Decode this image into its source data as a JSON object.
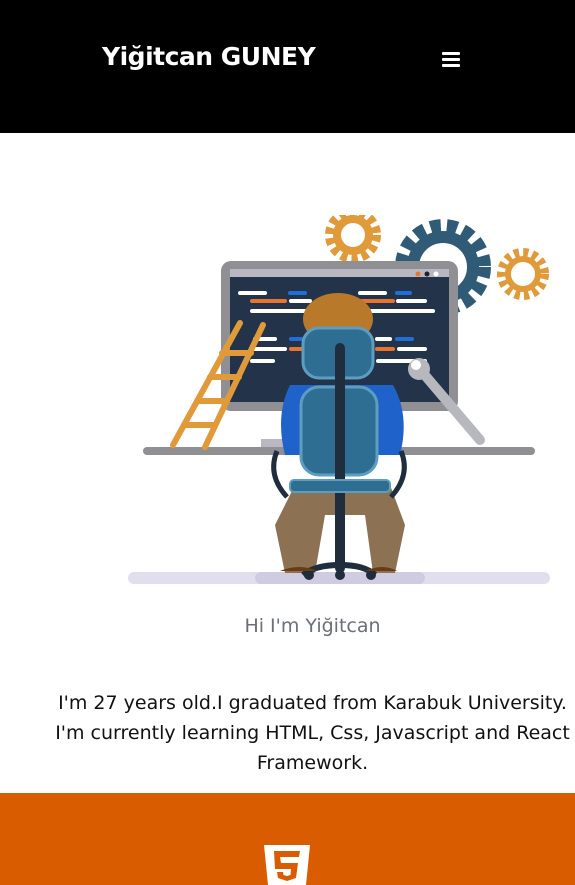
{
  "header": {
    "brand": "Yiğitcan GUNEY",
    "menu_icon": "hamburger-menu-icon",
    "background": "#000000"
  },
  "hero": {
    "illustration": "developer-at-computer-illustration",
    "greeting": "Hi I'm Yiğitcan",
    "about_line1": "I'm 27 years old.I graduated from Karabuk University.",
    "about_line2": "I'm currently learning HTML, Css, Javascript and React",
    "about_line3": "Framework."
  },
  "skills": {
    "background": "#d95c00",
    "logo_icon": "html5-logo-icon"
  }
}
